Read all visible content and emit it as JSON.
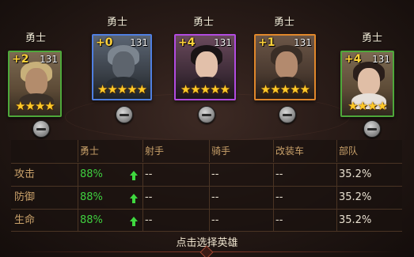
{
  "heroes": [
    {
      "name": "勇士",
      "plus": "+2",
      "level": "131",
      "stars": "★★★★",
      "frame": "green"
    },
    {
      "name": "勇士",
      "plus": "+0",
      "level": "131",
      "stars": "★★★★★",
      "frame": "blue"
    },
    {
      "name": "勇士",
      "plus": "+4",
      "level": "131",
      "stars": "★★★★★",
      "frame": "purple"
    },
    {
      "name": "勇士",
      "plus": "+1",
      "level": "131",
      "stars": "★★★★★",
      "frame": "orange"
    },
    {
      "name": "勇士",
      "plus": "+4",
      "level": "131",
      "stars": "★★★★",
      "frame": "green"
    }
  ],
  "stats": {
    "headers": [
      "",
      "勇士",
      "射手",
      "骑手",
      "改装车",
      "部队"
    ],
    "rows": [
      {
        "label": "攻击",
        "values": [
          "88%",
          "--",
          "--",
          "--",
          "35.2%"
        ]
      },
      {
        "label": "防御",
        "values": [
          "88%",
          "--",
          "--",
          "--",
          "35.2%"
        ]
      },
      {
        "label": "生命",
        "values": [
          "88%",
          "--",
          "--",
          "--",
          "35.2%"
        ]
      }
    ]
  },
  "hint": "点击选择英雄",
  "colors": {
    "positive": "#3fcf3f",
    "header": "#c9a16a",
    "gold": "#ffd23a"
  }
}
